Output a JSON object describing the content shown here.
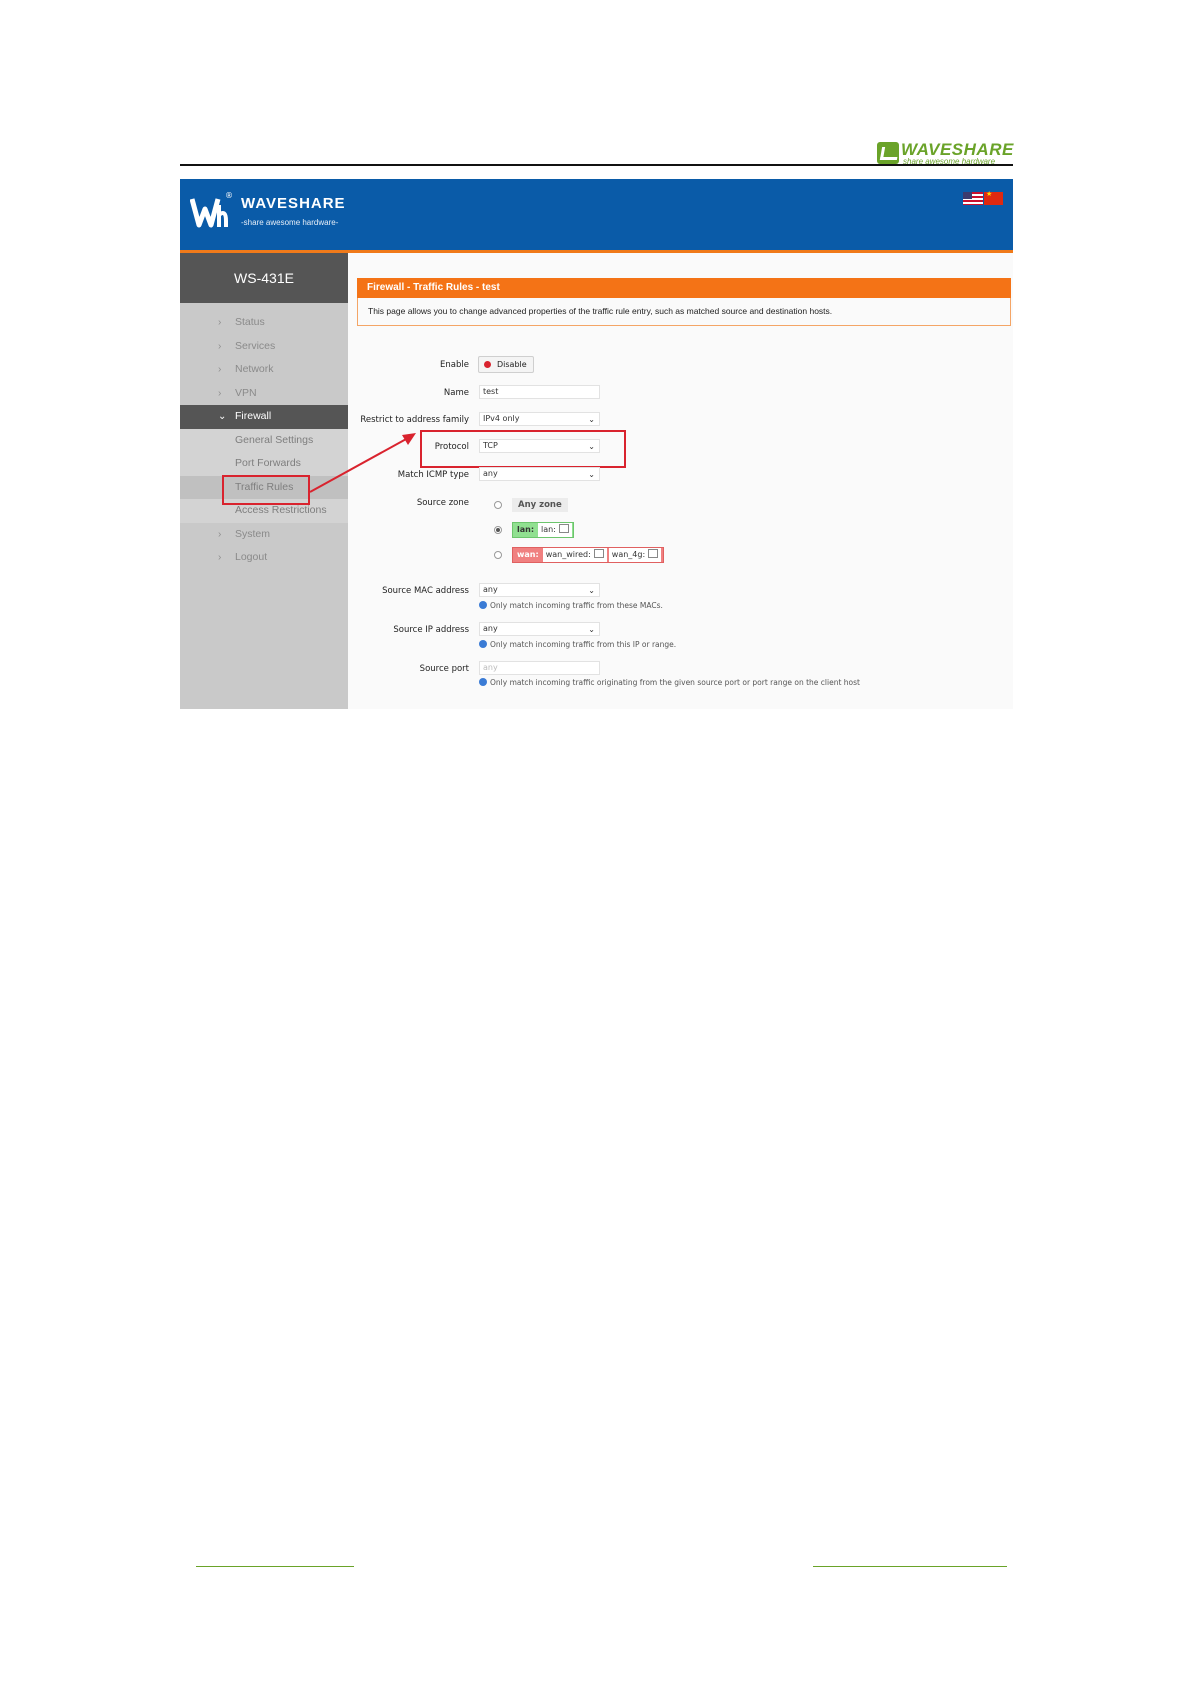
{
  "document": {
    "logo_word": "WAVESHARE",
    "logo_tagline": "share awesome hardware"
  },
  "topbar": {
    "brand_name": "WAVESHARE",
    "brand_reg": "®",
    "brand_tagline": "-share awesome hardware-",
    "flag_us_icon": "us-flag-icon",
    "flag_cn_icon": "china-flag-icon"
  },
  "sidebar": {
    "model": "WS-431E",
    "items": [
      {
        "label": "Status"
      },
      {
        "label": "Services"
      },
      {
        "label": "Network"
      },
      {
        "label": "VPN"
      },
      {
        "label": "Firewall"
      }
    ],
    "firewall_sub": [
      {
        "label": "General Settings"
      },
      {
        "label": "Port Forwards"
      },
      {
        "label": "Traffic Rules"
      },
      {
        "label": "Access Restrictions"
      }
    ],
    "items_after": [
      {
        "label": "System"
      },
      {
        "label": "Logout"
      }
    ]
  },
  "panel": {
    "title": "Firewall - Traffic Rules - test",
    "description": "This page allows you to change advanced properties of the traffic rule entry, such as matched source and destination hosts."
  },
  "form": {
    "enable": {
      "label": "Enable",
      "button": "Disable"
    },
    "name": {
      "label": "Name",
      "value": "test"
    },
    "family": {
      "label": "Restrict to address family",
      "value": "IPv4 only"
    },
    "protocol": {
      "label": "Protocol",
      "value": "TCP"
    },
    "icmp": {
      "label": "Match ICMP type",
      "value": "any"
    },
    "source_zone": {
      "label": "Source zone",
      "any": "Any zone",
      "lan_name": "lan:",
      "lan_net": "lan:",
      "wan_name": "wan:",
      "wan_net1": "wan_wired:",
      "wan_net2": "wan_4g:"
    },
    "src_mac": {
      "label": "Source MAC address",
      "value": "any",
      "hint": "Only match incoming traffic from these MACs."
    },
    "src_ip": {
      "label": "Source IP address",
      "value": "any",
      "hint": "Only match incoming traffic from this IP or range."
    },
    "src_port": {
      "label": "Source port",
      "placeholder": "any",
      "hint": "Only match incoming traffic originating from the given source port or port range on the client host"
    }
  },
  "colors": {
    "topbar": "#0a5ba8",
    "accent": "#f47316",
    "highlight": "#d9232e",
    "sidebar_active": "#555555"
  }
}
